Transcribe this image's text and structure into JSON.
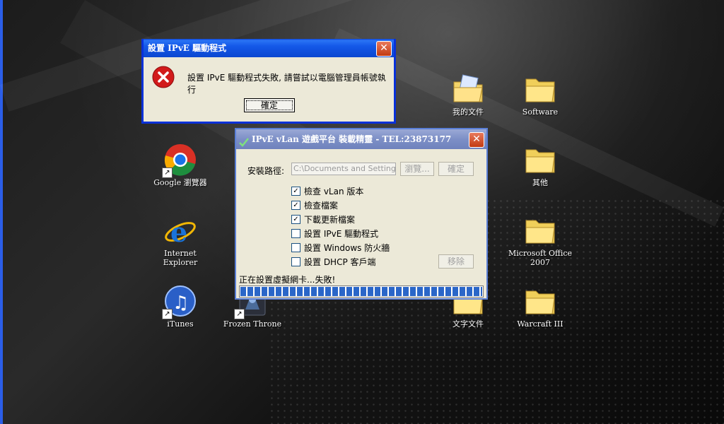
{
  "desktop": {
    "icons": [
      {
        "label": "我的文件"
      },
      {
        "label": "Software"
      },
      {
        "label": "Google 瀏覽器"
      },
      {
        "label": "其他"
      },
      {
        "label": "Internet Explorer"
      },
      {
        "label": "Microsoft Office 2007"
      },
      {
        "label": "iTunes"
      },
      {
        "label": "Frozen Throne"
      },
      {
        "label": "文字文件"
      },
      {
        "label": "Warcraft III"
      }
    ]
  },
  "error_dialog": {
    "title": "設置 IPvE 驅動程式",
    "message": "設置 IPvE 驅動程式失敗, 請嘗試以電腦管理員帳號執行",
    "ok_label": "確定",
    "close_glyph": "✕"
  },
  "installer": {
    "title": "IPvE vLan 遊戲平台 裝載精靈 - TEL:23873177",
    "install_path_label": "安裝路徑:",
    "install_path_value": "C:\\Documents and Settings\\Ar",
    "browse_label": "瀏覽...",
    "confirm_label": "確定",
    "remove_label": "移除",
    "close_glyph": "✕",
    "checklist": [
      {
        "label": "檢查 vLan 版本",
        "checked": true
      },
      {
        "label": "檢查檔案",
        "checked": true
      },
      {
        "label": "下載更新檔案",
        "checked": true
      },
      {
        "label": "設置 IPvE 驅動程式",
        "checked": false
      },
      {
        "label": "設置 Windows 防火牆",
        "checked": false
      },
      {
        "label": "設置 DHCP 客戶端",
        "checked": false
      }
    ],
    "status_text": "正在設置虛擬網卡...失敗!",
    "progress": 1.0
  },
  "colors": {
    "titlebar_active": "#0b47d0",
    "titlebar_inactive": "#7d8fc6",
    "error_red": "#d21a1a",
    "progress_blue": "#2a66c8"
  }
}
